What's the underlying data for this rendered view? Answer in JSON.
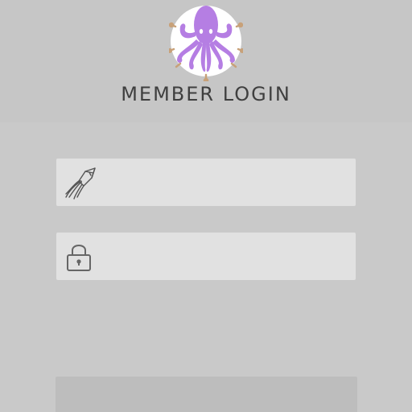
{
  "header": {
    "title": "MEMBER LOGIN",
    "logo_icon": "octopus-logo-icon"
  },
  "form": {
    "username": {
      "icon": "squid-icon",
      "value": "",
      "placeholder": ""
    },
    "password": {
      "icon": "padlock-icon",
      "value": "",
      "placeholder": ""
    },
    "submit_label": ""
  },
  "colors": {
    "background": "#c9c9c9",
    "field_background": "#e1e1e1",
    "logo_purple": "#b57ee3",
    "logo_accent": "#c8a179",
    "title_text": "#3f3f3f"
  }
}
